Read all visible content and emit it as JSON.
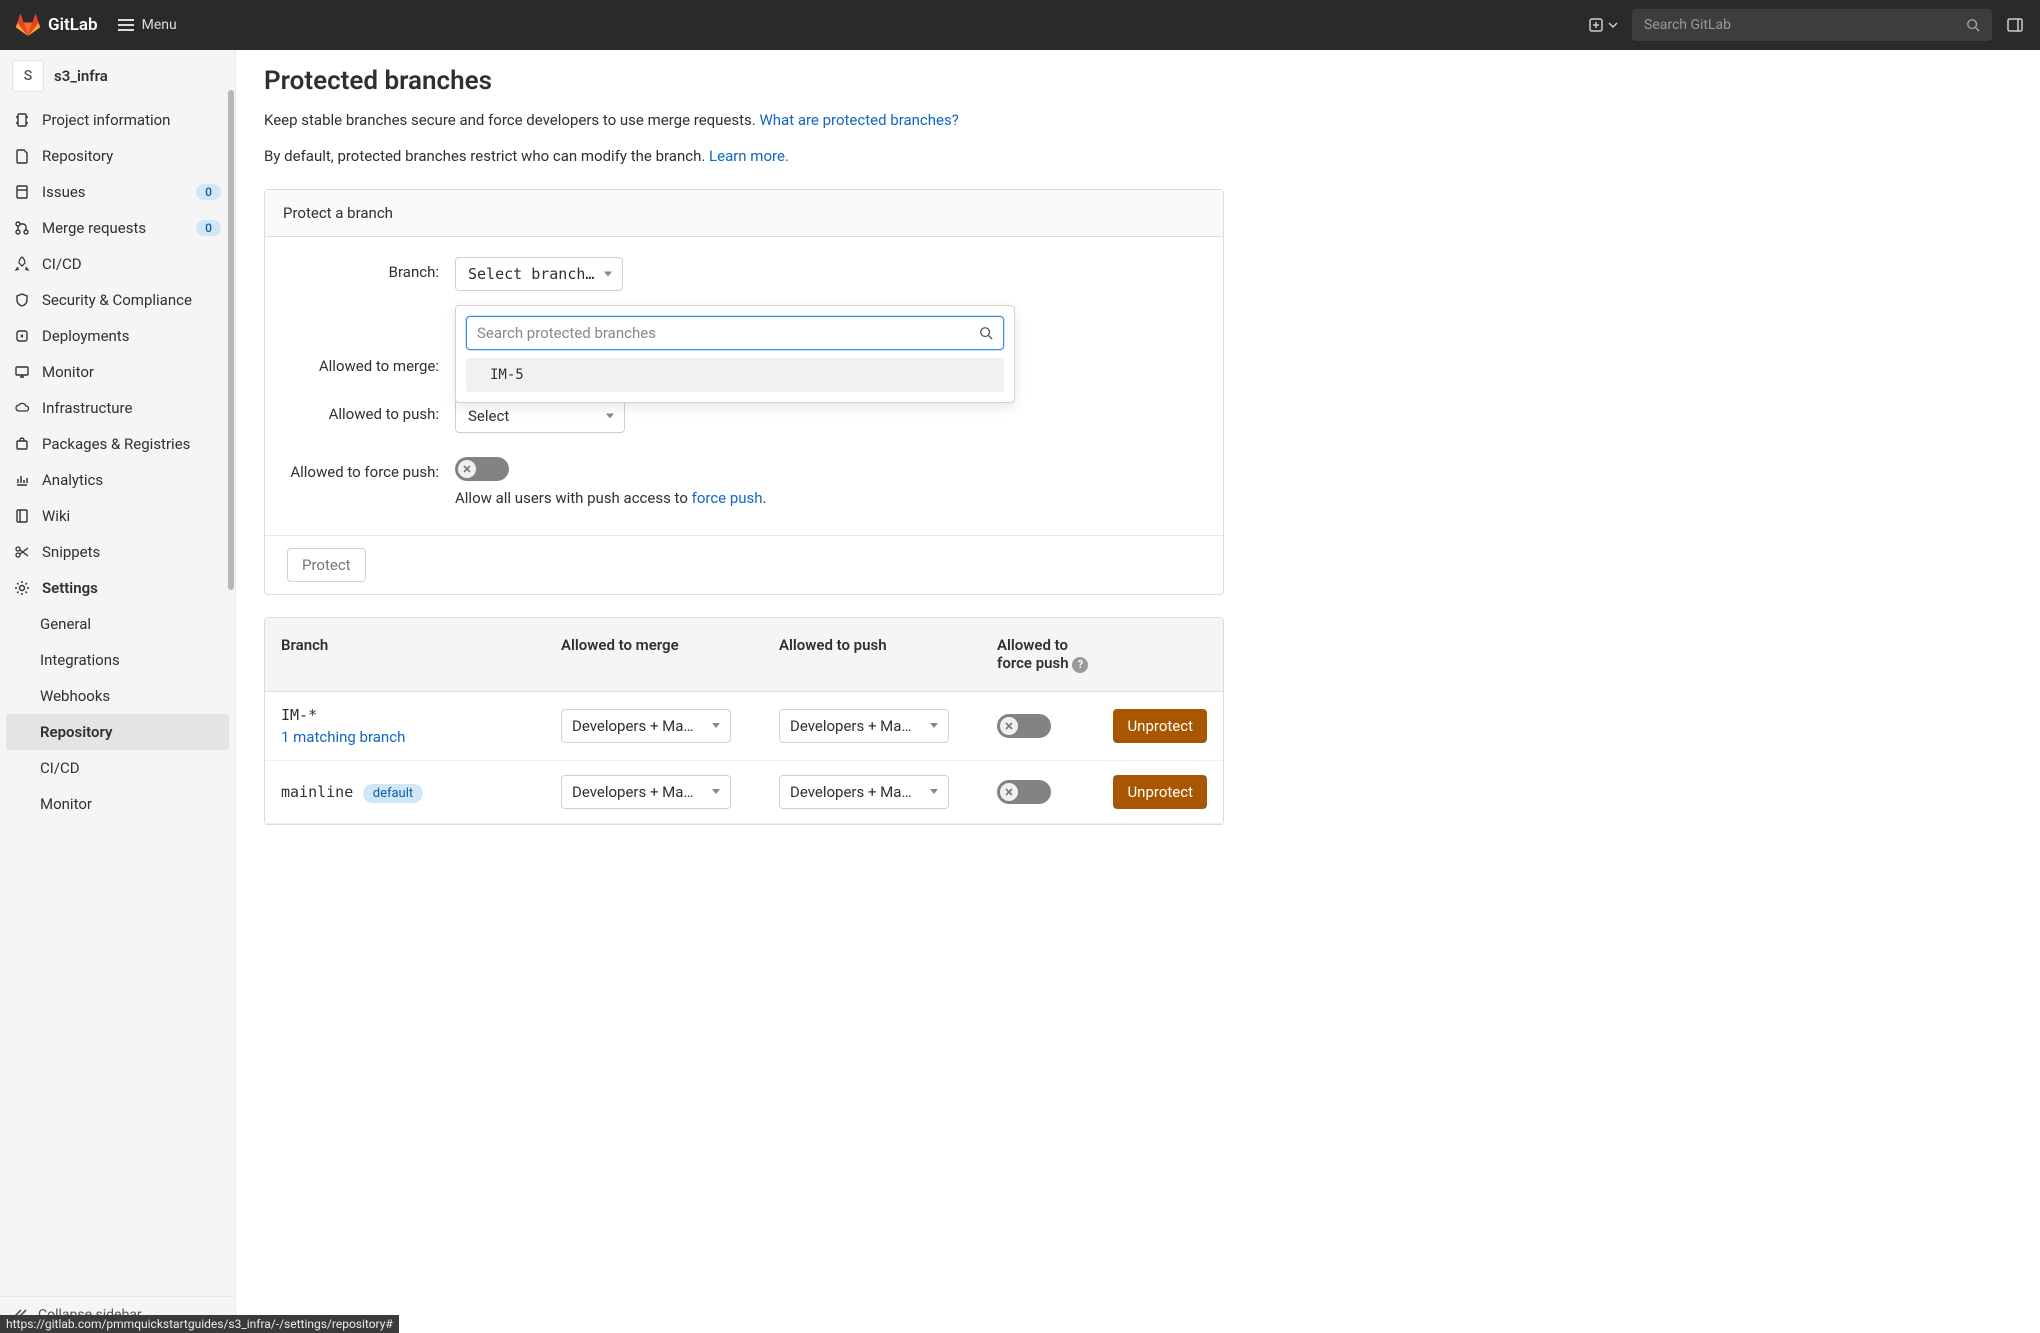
{
  "topbar": {
    "brand": "GitLab",
    "menu_label": "Menu",
    "search_placeholder": "Search GitLab"
  },
  "project": {
    "avatar_letter": "S",
    "name": "s3_infra"
  },
  "sidebar": {
    "items": [
      {
        "label": "Project information"
      },
      {
        "label": "Repository"
      },
      {
        "label": "Issues",
        "badge": "0"
      },
      {
        "label": "Merge requests",
        "badge": "0"
      },
      {
        "label": "CI/CD"
      },
      {
        "label": "Security & Compliance"
      },
      {
        "label": "Deployments"
      },
      {
        "label": "Monitor"
      },
      {
        "label": "Infrastructure"
      },
      {
        "label": "Packages & Registries"
      },
      {
        "label": "Analytics"
      },
      {
        "label": "Wiki"
      },
      {
        "label": "Snippets"
      },
      {
        "label": "Settings"
      }
    ],
    "settings_sub": [
      {
        "label": "General"
      },
      {
        "label": "Integrations"
      },
      {
        "label": "Webhooks"
      },
      {
        "label": "Repository"
      },
      {
        "label": "CI/CD"
      },
      {
        "label": "Monitor"
      }
    ],
    "collapse_label": "Collapse sidebar"
  },
  "main": {
    "title": "Protected branches",
    "desc1_prefix": "Keep stable branches secure and force developers to use merge requests. ",
    "desc1_link": "What are protected branches?",
    "desc2_prefix": "By default, protected branches restrict who can modify the branch. ",
    "desc2_link": "Learn more.",
    "panel_title": "Protect a branch",
    "form": {
      "branch_label": "Branch:",
      "branch_select_text": "Select branch…",
      "branch_search_placeholder": "Search protected branches",
      "branch_option_1": "IM-5",
      "merge_label": "Allowed to merge:",
      "push_label": "Allowed to push:",
      "push_select_text": "Select",
      "force_label": "Allowed to force push:",
      "force_helper_prefix": "Allow all users with push access to ",
      "force_helper_link": "force push",
      "force_helper_suffix": "."
    },
    "protect_button": "Protect",
    "table": {
      "col_branch": "Branch",
      "col_merge": "Allowed to merge",
      "col_push": "Allowed to push",
      "col_force": "Allowed to force push",
      "rows": [
        {
          "branch": "IM-*",
          "matching": "1 matching branch",
          "merge": "Developers + Ma…",
          "push": "Developers + Ma…",
          "action": "Unprotect"
        },
        {
          "branch": "mainline",
          "default_badge": "default",
          "merge": "Developers + Ma…",
          "push": "Developers + Ma…",
          "action": "Unprotect"
        }
      ]
    }
  },
  "status_url": "https://gitlab.com/pmmquickstartguides/s3_infra/-/settings/repository#"
}
